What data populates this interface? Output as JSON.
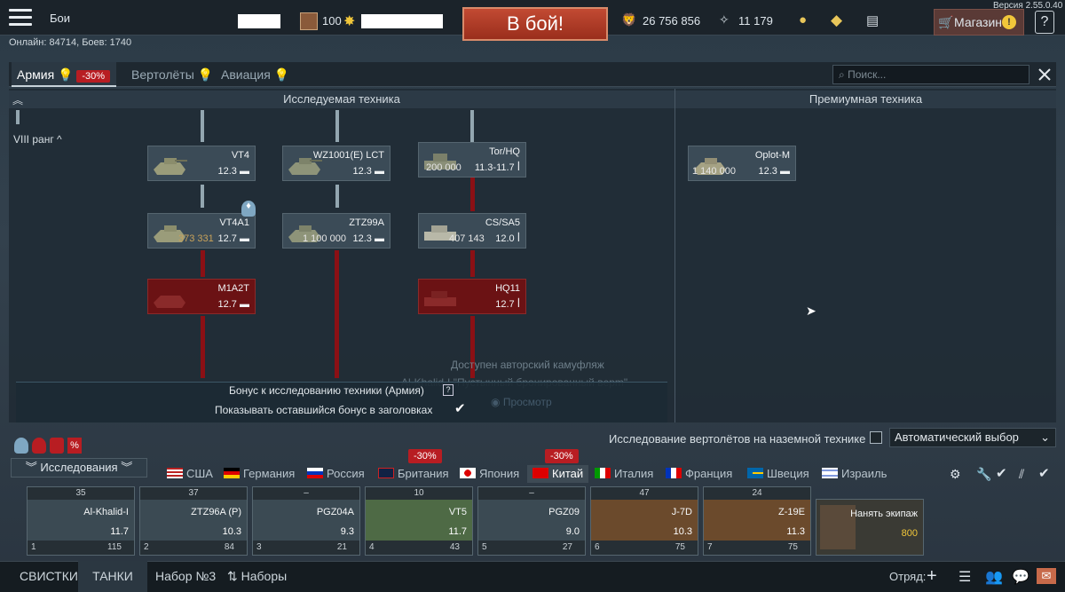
{
  "top": {
    "mode": "Бои",
    "level": "100",
    "play": "В бой!",
    "silver_lions": "26 756 856",
    "research_points": "11 179",
    "shop": "Магазин",
    "help": "?",
    "version": "Версия 2.55.0.40",
    "online": "Онлайн: 84714, Боев: 1740"
  },
  "tabs": [
    {
      "label": "Армия",
      "badge": "-30%"
    },
    {
      "label": "Вертолёты"
    },
    {
      "label": "Авиация"
    }
  ],
  "search_placeholder": "Поиск...",
  "research": {
    "heading_left": "Исследуемая техника",
    "heading_right": "Премиумная техника",
    "rank": "VIII ранг",
    "cards": [
      {
        "name": "VT4",
        "br": "12.3",
        "price": ""
      },
      {
        "name": "WZ1001(E) LCT",
        "br": "12.3",
        "price": ""
      },
      {
        "name": "Tor/HQ",
        "br": "11.3-11.7",
        "price": "200 000"
      },
      {
        "name": "VT4A1",
        "br": "12.7",
        "price": "373 331"
      },
      {
        "name": "ZTZ99A",
        "br": "12.3",
        "price": "1 100 000"
      },
      {
        "name": "CS/SA5",
        "br": "12.0",
        "price": "407 143"
      },
      {
        "name": "M1A2T",
        "br": "12.7",
        "price": ""
      },
      {
        "name": "HQ11",
        "br": "12.7",
        "price": ""
      }
    ],
    "premium_card": {
      "name": "Oplot-M",
      "br": "12.3",
      "price": "1 140 000"
    },
    "camo_line1": "Доступен авторский камуфляж",
    "camo_line2": "Al-Khalid-I \"Пустынный бронированный вepm\"",
    "camo_btn": "Просмотр",
    "bonus_text": "Бонус к исследованию техники (Армия)",
    "bonus_checkbox": "Показывать оставшийся бонус в заголовках"
  },
  "heli_research": "Исследование вертолётов на наземной технике",
  "auto_select": "Автоматический выбор",
  "research_btn": "Исследования",
  "nations": [
    {
      "label": "США",
      "badge": ""
    },
    {
      "label": "Германия",
      "badge": ""
    },
    {
      "label": "Россия",
      "badge": ""
    },
    {
      "label": "Британия",
      "badge": "-30%"
    },
    {
      "label": "Япония",
      "badge": ""
    },
    {
      "label": "Китай",
      "badge": "-30%"
    },
    {
      "label": "Италия",
      "badge": ""
    },
    {
      "label": "Франция",
      "badge": ""
    },
    {
      "label": "Швеция",
      "badge": ""
    },
    {
      "label": "Израиль",
      "badge": ""
    }
  ],
  "slots": [
    {
      "top": "35",
      "name": "Al-Khalid-I",
      "br": "11.7",
      "crew": "1",
      "rp": "115"
    },
    {
      "top": "37",
      "name": "ZTZ96A (P)",
      "br": "10.3",
      "crew": "2",
      "rp": "84"
    },
    {
      "top": "–",
      "name": "PGZ04A",
      "br": "9.3",
      "crew": "3",
      "rp": "21"
    },
    {
      "top": "10",
      "name": "VT5",
      "br": "11.7",
      "crew": "4",
      "rp": "43"
    },
    {
      "top": "–",
      "name": "PGZ09",
      "br": "9.0",
      "crew": "5",
      "rp": "27"
    },
    {
      "top": "47",
      "name": "J-7D",
      "br": "10.3",
      "crew": "6",
      "rp": "75"
    },
    {
      "top": "24",
      "name": "Z-19E",
      "br": "11.3",
      "crew": "7",
      "rp": "75"
    }
  ],
  "hire_crew": {
    "label": "Нанять экипаж",
    "cost": "800"
  },
  "bottom": {
    "whistles": "СВИСТКИ",
    "tanks": "ТАНКИ",
    "preset": "Набор №3",
    "presets": "Наборы",
    "squad": "Отряд:"
  }
}
